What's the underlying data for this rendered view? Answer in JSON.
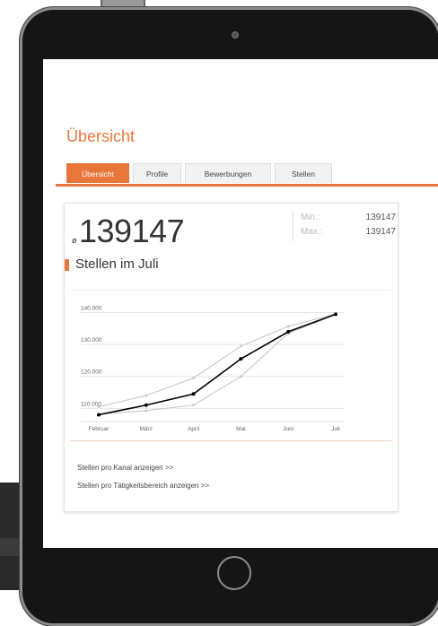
{
  "page": {
    "title": "Übersicht"
  },
  "tabs": [
    {
      "label": "Übersicht",
      "active": true
    },
    {
      "label": "Profile",
      "active": false
    },
    {
      "label": "Bewerbungen",
      "active": false
    },
    {
      "label": "Stellen",
      "active": false
    }
  ],
  "kpi": {
    "avg_symbol": "ø",
    "value": "139147",
    "min_label": "Min.:",
    "min_value": "139147",
    "max_label": "Max.:",
    "max_value": "139147",
    "subtitle": "Stellen im Juli"
  },
  "chart_data": {
    "type": "line",
    "categories": [
      "Februar",
      "März",
      "April",
      "Mai",
      "Juni",
      "Juli"
    ],
    "y_ticks": [
      "140.000",
      "130.000",
      "120.000",
      "110.000"
    ],
    "ylim": [
      107000,
      141000
    ],
    "series": [
      {
        "role": "main",
        "color": "#000000",
        "values": [
          108000,
          111000,
          114500,
          125500,
          134000,
          139500
        ]
      },
      {
        "role": "upper",
        "color": "#c8c8c8",
        "values": [
          110500,
          114000,
          119500,
          129500,
          135700,
          139600
        ]
      },
      {
        "role": "lower",
        "color": "#c8c8c8",
        "values": [
          108200,
          109300,
          111000,
          120000,
          133500,
          139400
        ]
      }
    ]
  },
  "links": {
    "kanal": "Stellen pro Kanal anzeigen >>",
    "taetigkeit": "Stellen pro Tätigkeitsbereich anzeigen >>"
  },
  "colors": {
    "accent": "#e8763b"
  }
}
